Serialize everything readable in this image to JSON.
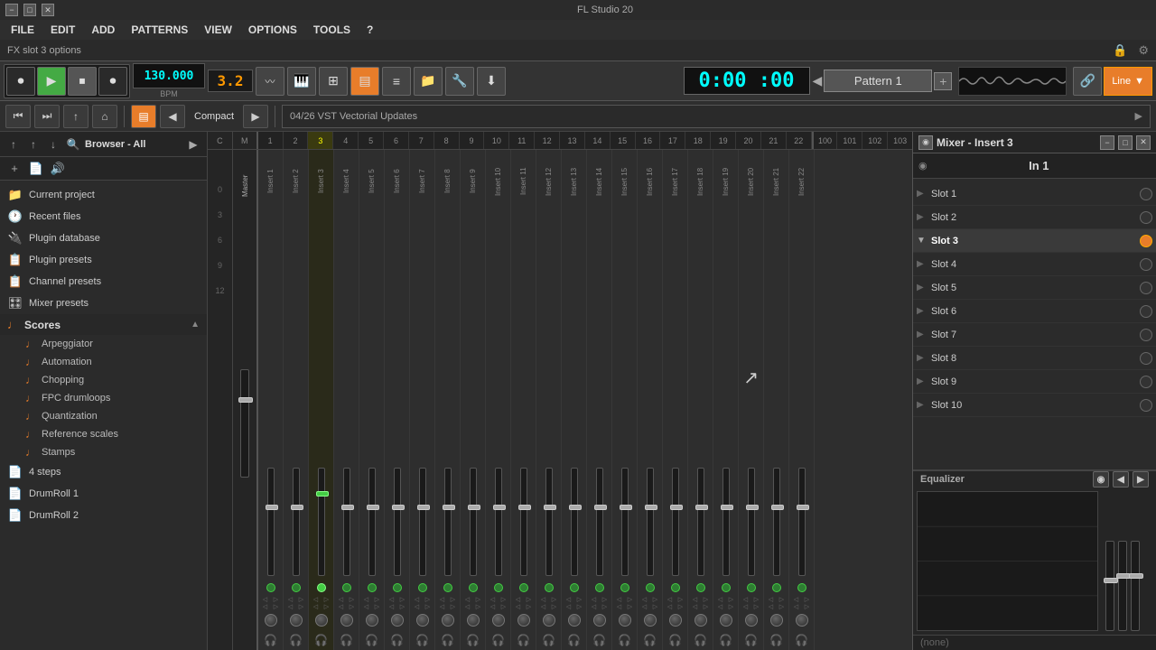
{
  "titlebar": {
    "title": "FL Studio 20",
    "min_label": "−",
    "max_label": "□",
    "close_label": "✕"
  },
  "menubar": {
    "items": [
      "FILE",
      "EDIT",
      "ADD",
      "PATTERNS",
      "VIEW",
      "OPTIONS",
      "TOOLS",
      "?"
    ]
  },
  "fxbar": {
    "text": "FX slot 3 options",
    "lock_icon": "🔒"
  },
  "toolbar": {
    "time": "0:00 :00",
    "bpm": "130.000",
    "pattern": "Pattern 1",
    "line_mode": "Line",
    "beat_pos": "3.2"
  },
  "toolbar2": {
    "compact_label": "Compact",
    "vst_text": "04/26  VST Vectorial Updates"
  },
  "browser": {
    "title": "Browser - All",
    "items": [
      {
        "label": "Current project",
        "icon": "📁"
      },
      {
        "label": "Recent files",
        "icon": "🕐"
      },
      {
        "label": "Plugin database",
        "icon": "🔌"
      },
      {
        "label": "Plugin presets",
        "icon": "📋"
      },
      {
        "label": "Channel presets",
        "icon": "📋"
      },
      {
        "label": "Mixer presets",
        "icon": "🎛"
      }
    ],
    "scores_label": "Scores",
    "scores_items": [
      "Arpeggiator",
      "Automation",
      "Chopping",
      "FPC drumloops",
      "Quantization",
      "Reference scales",
      "Stamps"
    ],
    "bottom_items": [
      {
        "label": "4 steps",
        "icon": "📄"
      },
      {
        "label": "DrumRoll 1",
        "icon": "📄"
      },
      {
        "label": "DrumRoll 2",
        "icon": "📄"
      }
    ]
  },
  "channel_numbers": [
    "C",
    "M",
    "1",
    "2",
    "3",
    "4",
    "5",
    "6",
    "7",
    "8",
    "9",
    "10",
    "11",
    "12",
    "13",
    "14",
    "15",
    "16",
    "17",
    "18",
    "19",
    "20",
    "21",
    "22",
    "2"
  ],
  "channel_numbers_right": [
    "100",
    "101",
    "102",
    "103"
  ],
  "mixer_panel": {
    "title": "Mixer - Insert 3",
    "input_label": "In 1",
    "slots": [
      {
        "label": "Slot 1",
        "active": false,
        "open": false
      },
      {
        "label": "Slot 2",
        "active": false,
        "open": false
      },
      {
        "label": "Slot 3",
        "active": true,
        "open": true
      },
      {
        "label": "Slot 4",
        "active": false,
        "open": false
      },
      {
        "label": "Slot 5",
        "active": false,
        "open": false
      },
      {
        "label": "Slot 6",
        "active": false,
        "open": false
      },
      {
        "label": "Slot 7",
        "active": false,
        "open": false
      },
      {
        "label": "Slot 8",
        "active": false,
        "open": false
      },
      {
        "label": "Slot 9",
        "active": false,
        "open": false
      },
      {
        "label": "Slot 10",
        "active": false,
        "open": false
      }
    ],
    "eq_label": "Equalizer",
    "none_label": "(none)"
  },
  "colors": {
    "accent_orange": "#e87d2a",
    "active_green": "#4c4",
    "bg_dark": "#2b2b2b",
    "text_light": "#ddd"
  }
}
